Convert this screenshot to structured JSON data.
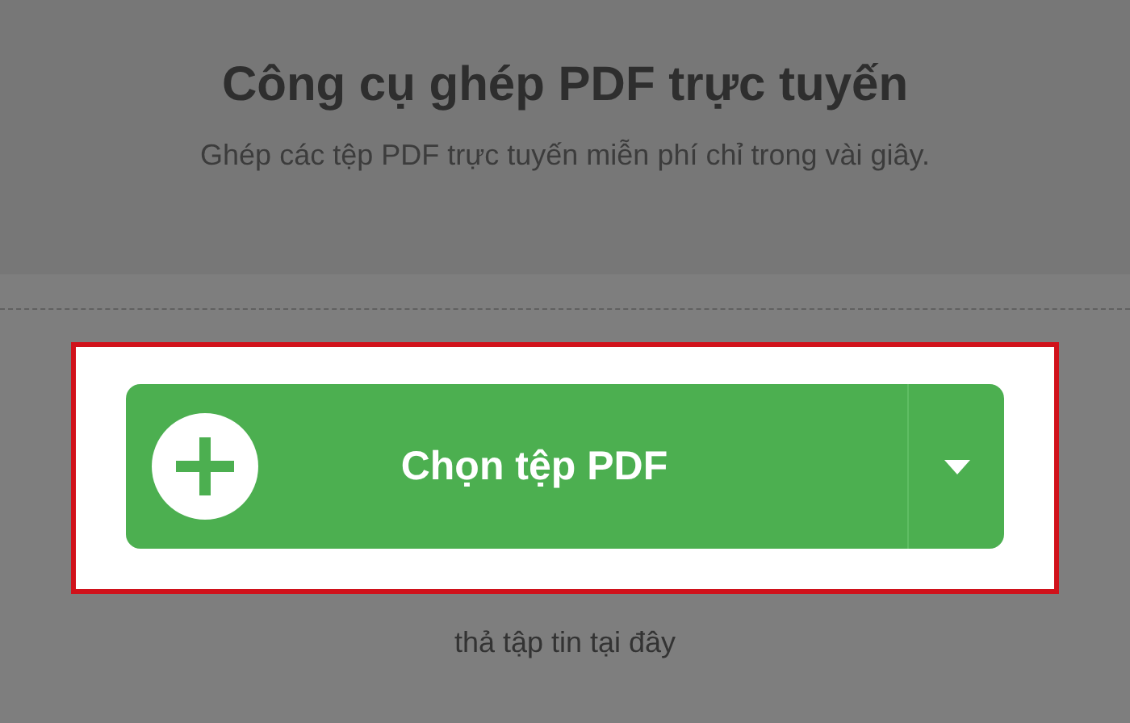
{
  "header": {
    "title": "Công cụ ghép PDF trực tuyến",
    "subtitle": "Ghép các tệp PDF trực tuyến miễn phí chỉ trong vài giây."
  },
  "upload": {
    "button_label": "Chọn tệp PDF",
    "drop_hint": "thả tập tin tại đây"
  }
}
